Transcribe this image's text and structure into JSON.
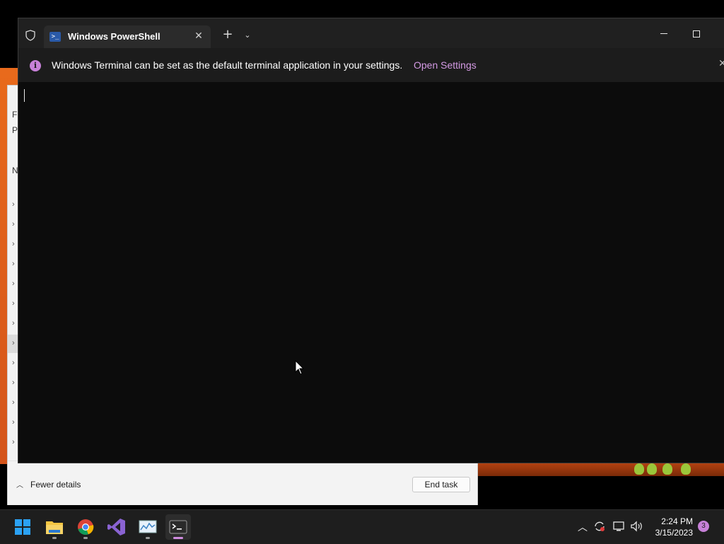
{
  "terminal": {
    "tab_title": "Windows PowerShell",
    "new_tab_symbol": "+",
    "infobar": {
      "message": "Windows Terminal can be set as the default terminal application in your settings.",
      "link_label": "Open Settings"
    }
  },
  "task_manager": {
    "left_letters": [
      "F",
      "P",
      "N"
    ],
    "fewer_details_label": "Fewer details",
    "end_task_label": "End task"
  },
  "taskbar": {
    "apps": [
      "start-icon",
      "file-explorer-icon",
      "chrome-icon",
      "visual-studio-icon",
      "resource-monitor-icon",
      "terminal-icon"
    ],
    "active_app": "terminal-icon",
    "clock": {
      "time": "2:24 PM",
      "date": "3/15/2023"
    },
    "notification_count": "3"
  },
  "colors": {
    "accent": "#c781d8",
    "link": "#d49ae4",
    "terminal_bg": "#0c0c0c",
    "tabbar_bg": "#202020"
  }
}
